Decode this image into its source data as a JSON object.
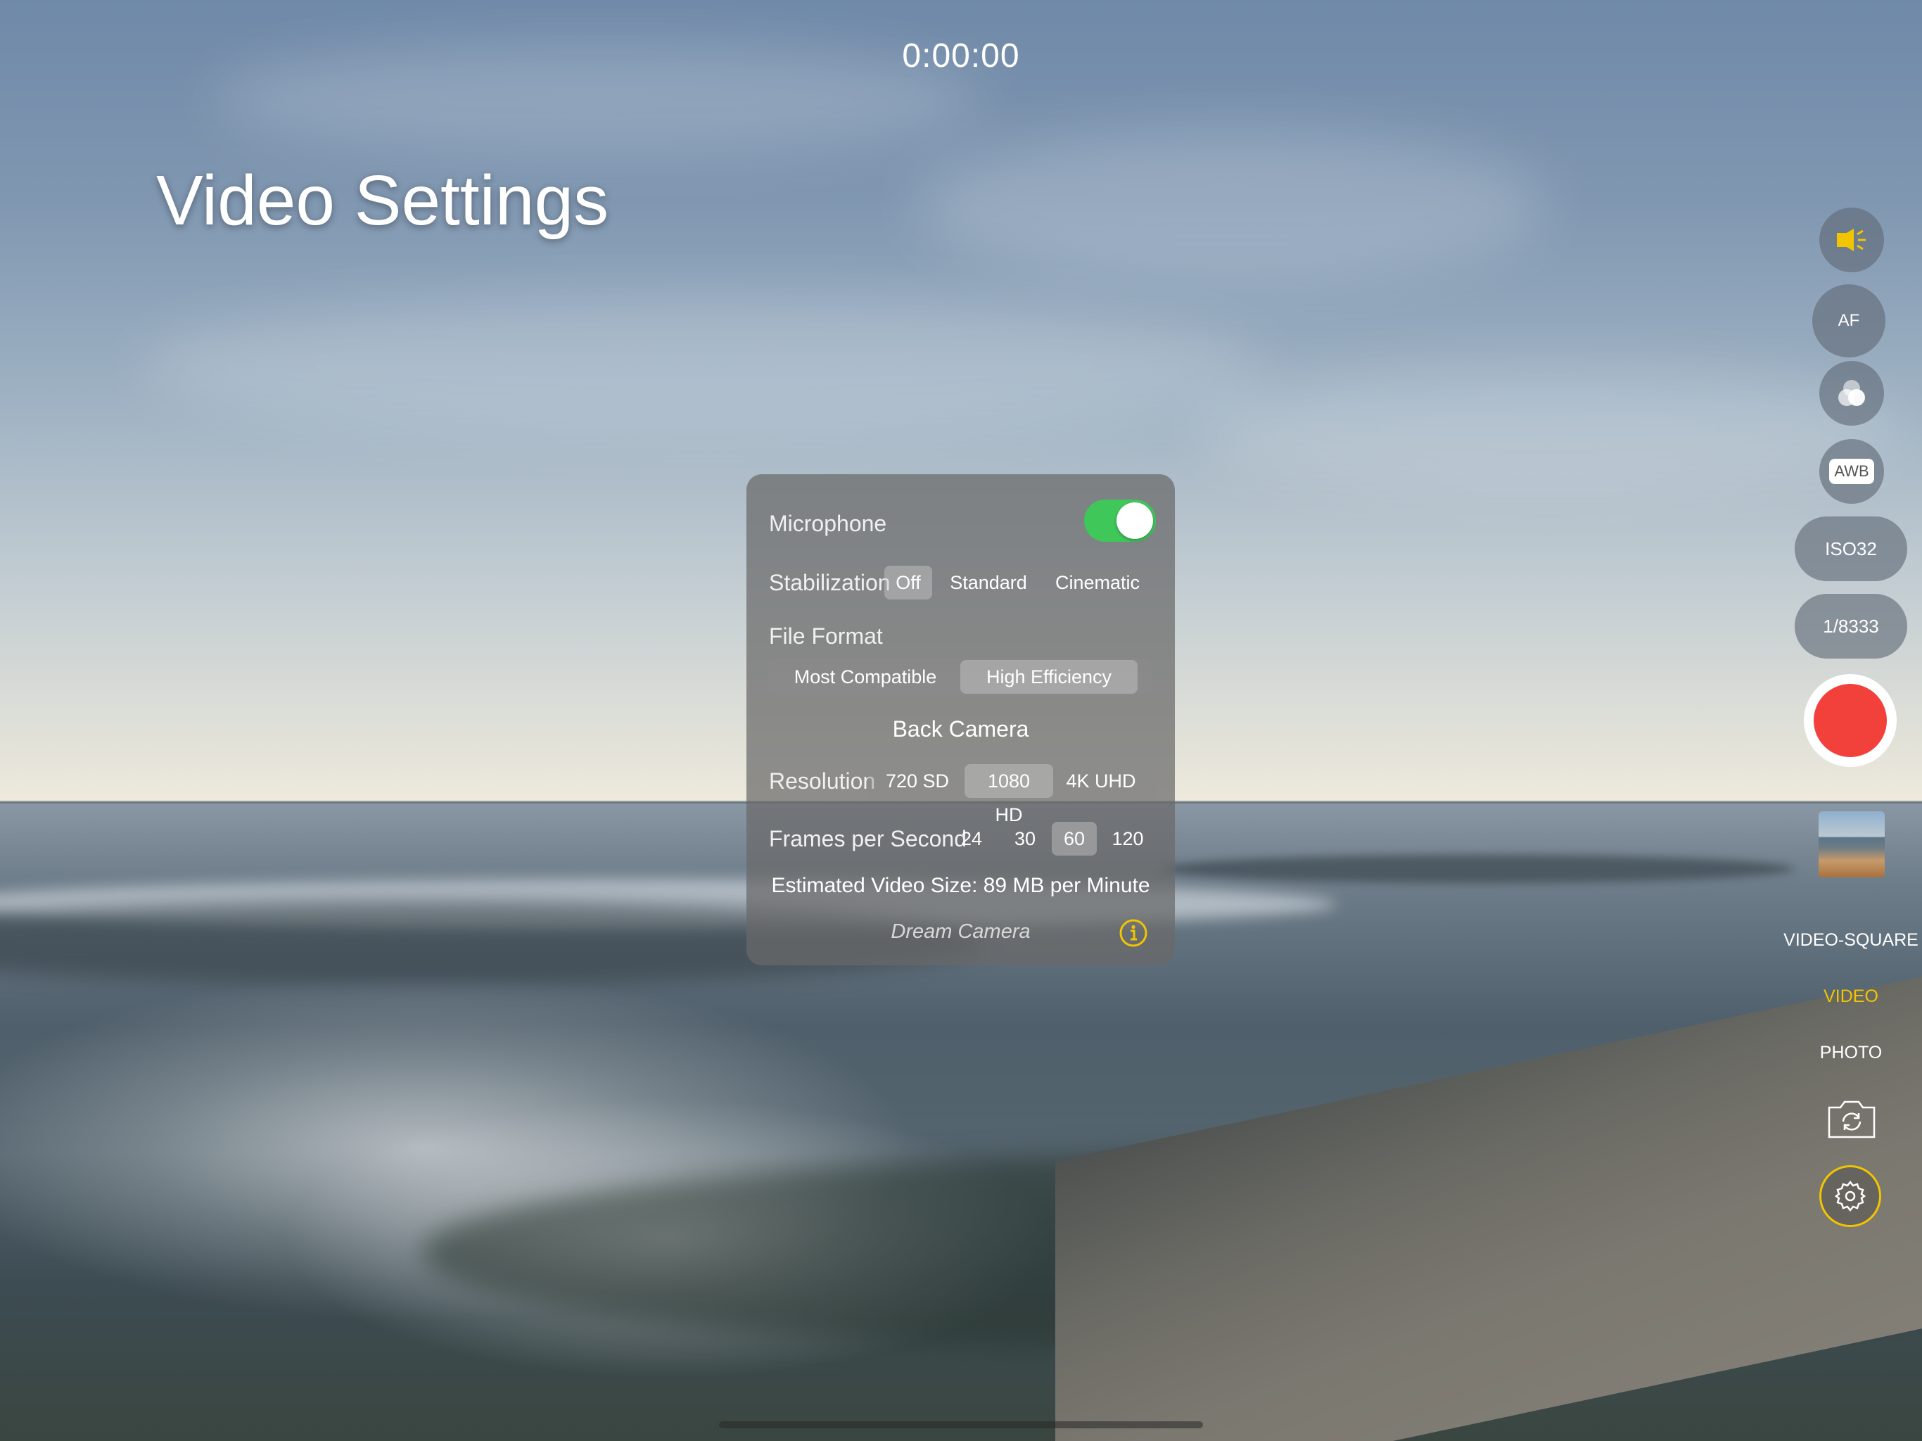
{
  "timer": "0:00:00",
  "title": "Video Settings",
  "panel": {
    "microphone_label": "Microphone",
    "microphone_on": true,
    "stabilization_label": "Stabilization",
    "stabilization_options": [
      "Off",
      "Standard",
      "Cinematic"
    ],
    "stabilization_selected": "Off",
    "file_format_label": "File Format",
    "file_format_options": [
      "Most Compatible",
      "High Efficiency"
    ],
    "file_format_selected": "High Efficiency",
    "camera_label": "Back Camera",
    "resolution_label": "Resolution",
    "resolution_options": [
      "720 SD",
      "1080 HD",
      "4K UHD"
    ],
    "resolution_selected": "1080 HD",
    "fps_label": "Frames per Second",
    "fps_options": [
      "24",
      "30",
      "60",
      "120"
    ],
    "fps_selected": "60",
    "estimate": "Estimated Video Size: 89 MB per Minute",
    "brand": "Dream Camera"
  },
  "controls": {
    "af": "AF",
    "awb": "AWB",
    "iso": "ISO32",
    "shutter": "1/8333",
    "modes": [
      "VIDEO-SQUARE",
      "VIDEO",
      "PHOTO"
    ],
    "active_mode": "VIDEO"
  },
  "colors": {
    "accent": "#f2c500",
    "record": "#f2403a",
    "toggle_on": "#3fc75a"
  },
  "icons": [
    "torch-icon",
    "filter-icon",
    "switch-camera-icon",
    "settings-gear-icon",
    "info-icon"
  ]
}
